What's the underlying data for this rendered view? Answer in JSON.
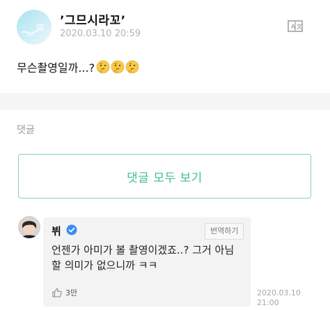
{
  "post": {
    "author": "’그므시라꼬’",
    "timestamp": "2020.03.10 20:59",
    "text": "무슨촬영일까...?",
    "emojis": [
      "thinking-face-emoji",
      "thinking-face-emoji",
      "thinking-face-emoji"
    ],
    "translate_icon": "translate-icon"
  },
  "comments_section": {
    "label": "댓글",
    "view_all_label": "댓글 모두 보기"
  },
  "comment": {
    "author": "뷔",
    "verified": true,
    "translate_label": "번역하기",
    "text": "언젠가 아미가 볼 촬영이겠죠..? 그거 아님 할 의미가 없으니까 ㅋㅋ",
    "like_count": "3만",
    "timestamp": "2020.03.10 21:00"
  },
  "colors": {
    "accent_green": "#3fbf8a",
    "verified_blue": "#3d8cf5",
    "bubble_bg": "#f3f3f3"
  }
}
